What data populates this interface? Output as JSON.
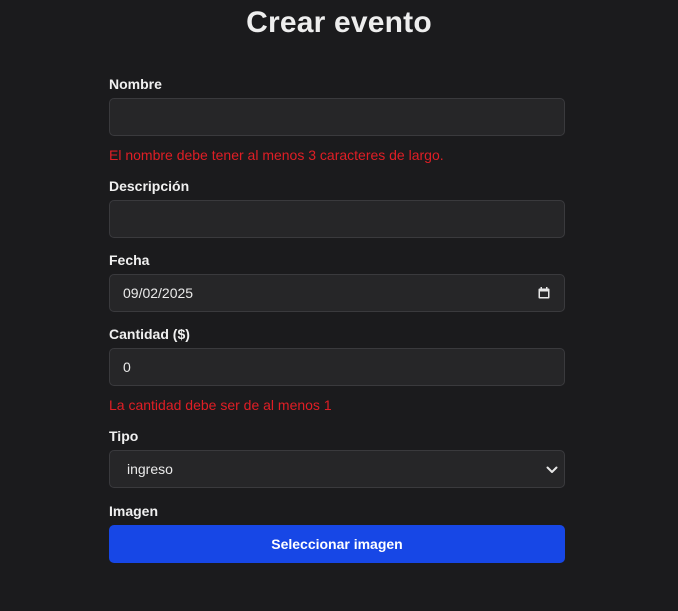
{
  "page": {
    "title": "Crear evento"
  },
  "form": {
    "nombre": {
      "label": "Nombre",
      "value": "",
      "error": "El nombre debe tener al menos 3 caracteres de largo."
    },
    "descripcion": {
      "label": "Descripción",
      "value": ""
    },
    "fecha": {
      "label": "Fecha",
      "value": "09/02/2025",
      "icon": "calendar-icon"
    },
    "cantidad": {
      "label": "Cantidad ($)",
      "value": "0",
      "error": "La cantidad debe ser de al menos 1"
    },
    "tipo": {
      "label": "Tipo",
      "value": "ingreso",
      "icon": "chevron-down-icon"
    },
    "imagen": {
      "label": "Imagen",
      "button_label": "Seleccionar imagen"
    }
  },
  "colors": {
    "background": "#1b1b1d",
    "input_background": "#262628",
    "error": "#e01e25",
    "primary_button": "#1747e6"
  }
}
